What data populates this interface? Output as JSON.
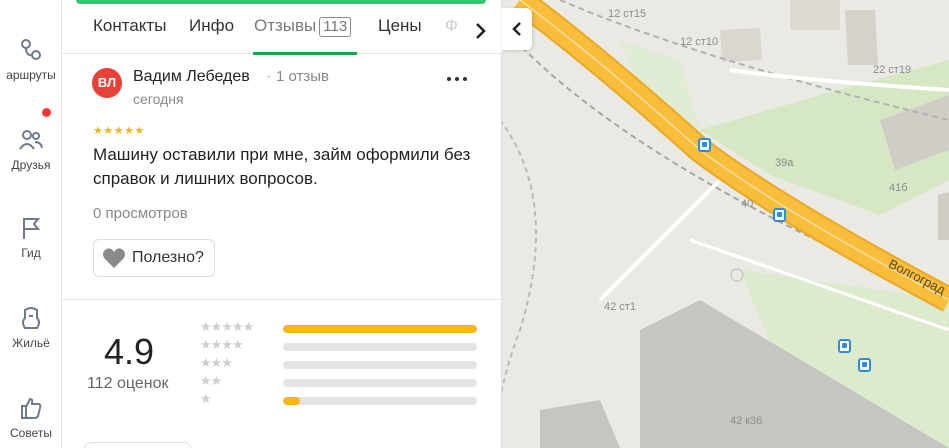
{
  "sidenav": {
    "items": [
      {
        "label": "аршруты",
        "icon": "routes-icon"
      },
      {
        "label": "Друзья",
        "icon": "friends-icon"
      },
      {
        "label": "Гид",
        "icon": "flag-icon"
      },
      {
        "label": "Жильё",
        "icon": "housing-icon"
      },
      {
        "label": "Советы",
        "icon": "thumbs-up-icon"
      }
    ],
    "friends_notification_color": "#ff3333"
  },
  "tabs": {
    "items": [
      {
        "label": "Контакты"
      },
      {
        "label": "Инфо"
      },
      {
        "label": "Отзывы",
        "count": "113",
        "active": true
      },
      {
        "label": "Цены"
      }
    ],
    "faded_label": "Ф",
    "next_icon": "chevron-right-icon",
    "active_color": "#23a24a"
  },
  "review": {
    "avatar_initials": "ВЛ",
    "avatar_color": "#e7413a",
    "author_name": "Вадим Лебедев",
    "author_separator": "·",
    "author_reviews": "1 отзыв",
    "date": "сегодня",
    "rating": 5,
    "stars": "★★★★★",
    "text": "Машину оставили при мне, займ оформили без справок и лишних вопросов.",
    "views": "0 просмотров",
    "helpful_label": "Полезно?",
    "helpful_icon": "heart-icon"
  },
  "summary": {
    "rating": "4.9",
    "count_label": "112 оценок",
    "distribution": [
      {
        "stars": 5,
        "glyphs": "★★★★★",
        "fraction": 1.0
      },
      {
        "stars": 4,
        "glyphs": "★★★★",
        "fraction": 0.0
      },
      {
        "stars": 3,
        "glyphs": "★★★",
        "fraction": 0.0
      },
      {
        "stars": 2,
        "glyphs": "★★",
        "fraction": 0.0
      },
      {
        "stars": 1,
        "glyphs": "★",
        "fraction": 0.09
      }
    ],
    "bar_color": "#f6b61c"
  },
  "map": {
    "labels": [
      "12 ст15",
      "12 ст10",
      "22 ст19",
      "39а",
      "41б",
      "40",
      "42 ст1",
      "42 к36"
    ],
    "street_name": "Волгоград",
    "collapse_icon": "chevron-left-icon"
  }
}
